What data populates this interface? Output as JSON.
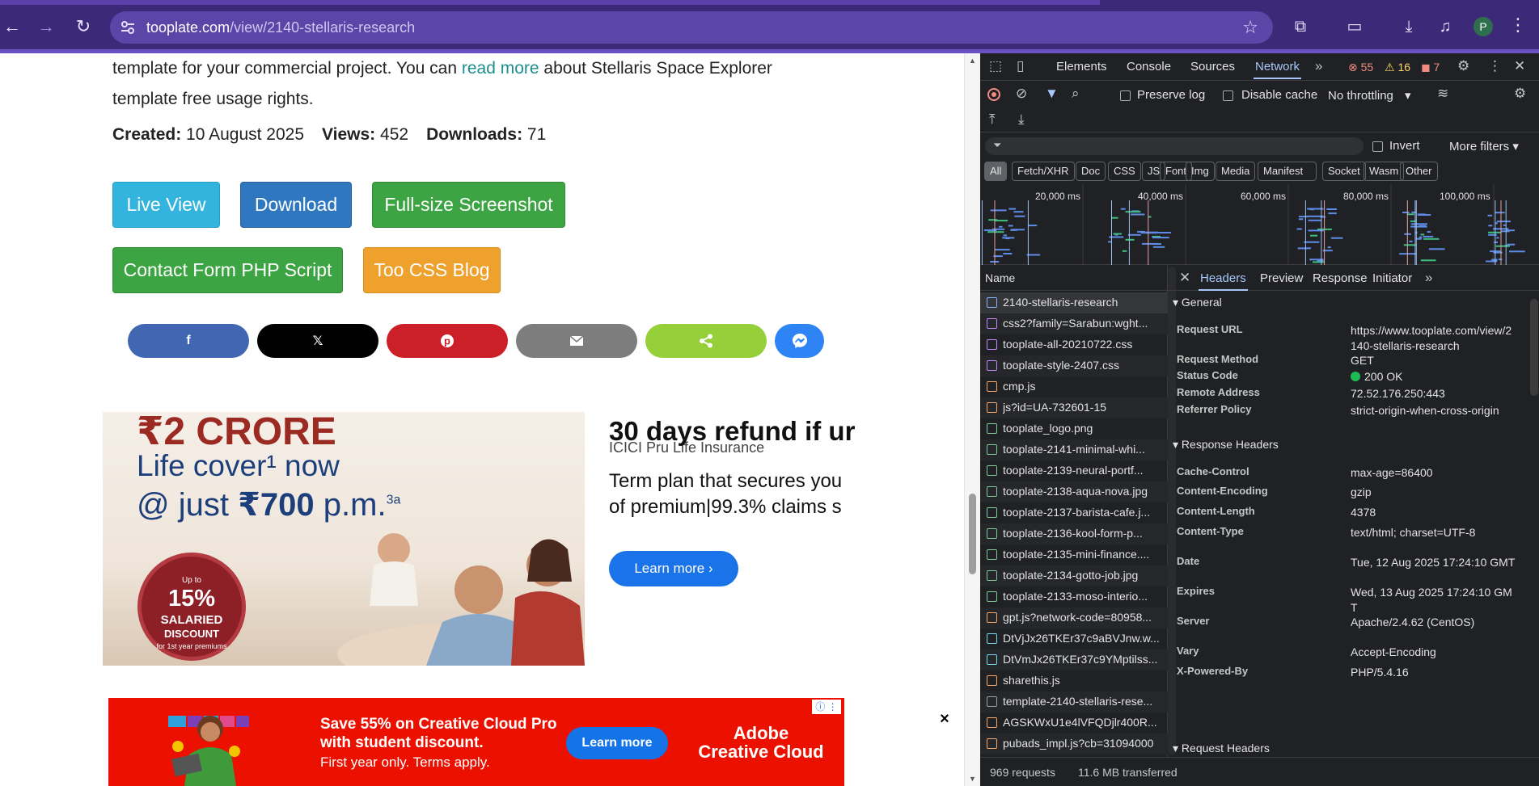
{
  "browser": {
    "url_host": "tooplate.com",
    "url_path": "/view/2140-stellaris-research",
    "avatar_letter": "P"
  },
  "page": {
    "para_text_1": "template for your commercial project. You can ",
    "para_link": "read more",
    "para_text_2": " about Stellaris Space Explorer template free usage rights.",
    "created_label": "Created:",
    "created_value": "10 August 2025",
    "views_label": "Views:",
    "views_value": "452",
    "downloads_label": "Downloads:",
    "downloads_value": "71",
    "buttons": {
      "live_view": "Live View",
      "download": "Download",
      "full_size": "Full-size Screenshot",
      "contact_form": "Contact Form PHP Script",
      "css_blog": "Too CSS Blog"
    },
    "share": {
      "facebook": "f",
      "x": "𝕏"
    }
  },
  "ad1": {
    "headline_amount": "₹2 CRORE",
    "line2": "Life cover¹ now",
    "line3_prefix": "@ just ",
    "line3_price": "₹700",
    "line3_suffix": " p.m.",
    "line3_sup": "3a",
    "seal_upto": "Up to",
    "seal_pct": "15%",
    "seal_word1": "SALARIED",
    "seal_word2": "DISCOUNT",
    "seal_foot": "for 1st year premiums",
    "brand": "ICICI Pru Life Insurance",
    "title": "30 days refund if ur",
    "body_line1": "Term plan that secures you",
    "body_line2": "of premium|99.3% claims s",
    "cta": "Learn more ›"
  },
  "ad2": {
    "line1": "Save 55% on Creative Cloud Pro",
    "line2": "with student discount.",
    "line3": "First year only. Terms apply.",
    "cta": "Learn more",
    "brand_line1": "Adobe",
    "brand_line2": "Creative Cloud"
  },
  "devtools": {
    "tabs": [
      "Elements",
      "Console",
      "Sources",
      "Network"
    ],
    "active_tab": "Network",
    "errors": "55",
    "warnings": "16",
    "issues": "7",
    "preserve_log": "Preserve log",
    "disable_cache": "Disable cache",
    "throttling": "No throttling",
    "invert": "Invert",
    "more_filters": "More filters",
    "type_filters": [
      "All",
      "Fetch/XHR",
      "Doc",
      "CSS",
      "JS",
      "Font",
      "Img",
      "Media",
      "Manifest",
      "Socket",
      "Wasm",
      "Other"
    ],
    "timeline_labels": [
      "20,000 ms",
      "40,000 ms",
      "60,000 ms",
      "80,000 ms",
      "100,000 ms"
    ],
    "name_header": "Name",
    "requests": [
      {
        "name": "2140-stellaris-research",
        "kind": "doc"
      },
      {
        "name": "css2?family=Sarabun:wght...",
        "kind": "css"
      },
      {
        "name": "tooplate-all-20210722.css",
        "kind": "css"
      },
      {
        "name": "tooplate-style-2407.css",
        "kind": "css"
      },
      {
        "name": "cmp.js",
        "kind": "js"
      },
      {
        "name": "js?id=UA-732601-15",
        "kind": "js"
      },
      {
        "name": "tooplate_logo.png",
        "kind": "img"
      },
      {
        "name": "tooplate-2141-minimal-whi...",
        "kind": "img"
      },
      {
        "name": "tooplate-2139-neural-portf...",
        "kind": "img"
      },
      {
        "name": "tooplate-2138-aqua-nova.jpg",
        "kind": "img"
      },
      {
        "name": "tooplate-2137-barista-cafe.j...",
        "kind": "img"
      },
      {
        "name": "tooplate-2136-kool-form-p...",
        "kind": "img"
      },
      {
        "name": "tooplate-2135-mini-finance....",
        "kind": "img"
      },
      {
        "name": "tooplate-2134-gotto-job.jpg",
        "kind": "img"
      },
      {
        "name": "tooplate-2133-moso-interio...",
        "kind": "img"
      },
      {
        "name": "gpt.js?network-code=80958...",
        "kind": "js"
      },
      {
        "name": "DtVjJx26TKEr37c9aBVJnw.w...",
        "kind": "font"
      },
      {
        "name": "DtVmJx26TKEr37c9YMptilss...",
        "kind": "font"
      },
      {
        "name": "sharethis.js",
        "kind": "js"
      },
      {
        "name": "template-2140-stellaris-rese...",
        "kind": "other"
      },
      {
        "name": "AGSKWxU1e4lVFQDjlr400R...",
        "kind": "js"
      },
      {
        "name": "pubads_impl.js?cb=31094000",
        "kind": "js"
      }
    ],
    "detail_tabs": [
      "Headers",
      "Preview",
      "Response",
      "Initiator"
    ],
    "active_detail_tab": "Headers",
    "general_label": "General",
    "general": [
      {
        "k": "Request URL",
        "v": "https://www.tooplate.com/view/2140-stellaris-research"
      },
      {
        "k": "Request Method",
        "v": "GET"
      },
      {
        "k": "Status Code",
        "v": "200 OK"
      },
      {
        "k": "Remote Address",
        "v": "72.52.176.250:443"
      },
      {
        "k": "Referrer Policy",
        "v": "strict-origin-when-cross-origin"
      }
    ],
    "response_headers_label": "Response Headers",
    "response_headers": [
      {
        "k": "Cache-Control",
        "v": "max-age=86400"
      },
      {
        "k": "Content-Encoding",
        "v": "gzip"
      },
      {
        "k": "Content-Length",
        "v": "4378"
      },
      {
        "k": "Content-Type",
        "v": "text/html; charset=UTF-8"
      },
      {
        "k": "Date",
        "v": "Tue, 12 Aug 2025 17:24:10 GMT"
      },
      {
        "k": "Expires",
        "v": "Wed, 13 Aug 2025 17:24:10 GMT"
      },
      {
        "k": "Server",
        "v": "Apache/2.4.62 (CentOS)"
      },
      {
        "k": "Vary",
        "v": "Accept-Encoding"
      },
      {
        "k": "X-Powered-By",
        "v": "PHP/5.4.16"
      }
    ],
    "request_headers_label": "Request Headers",
    "request_count": "969 requests",
    "transferred": "11.6 MB transferred"
  },
  "colors": {
    "browser_frame": "#3c2a78",
    "devtools_bg": "#202124",
    "accent_blue": "#a8c7fa"
  }
}
